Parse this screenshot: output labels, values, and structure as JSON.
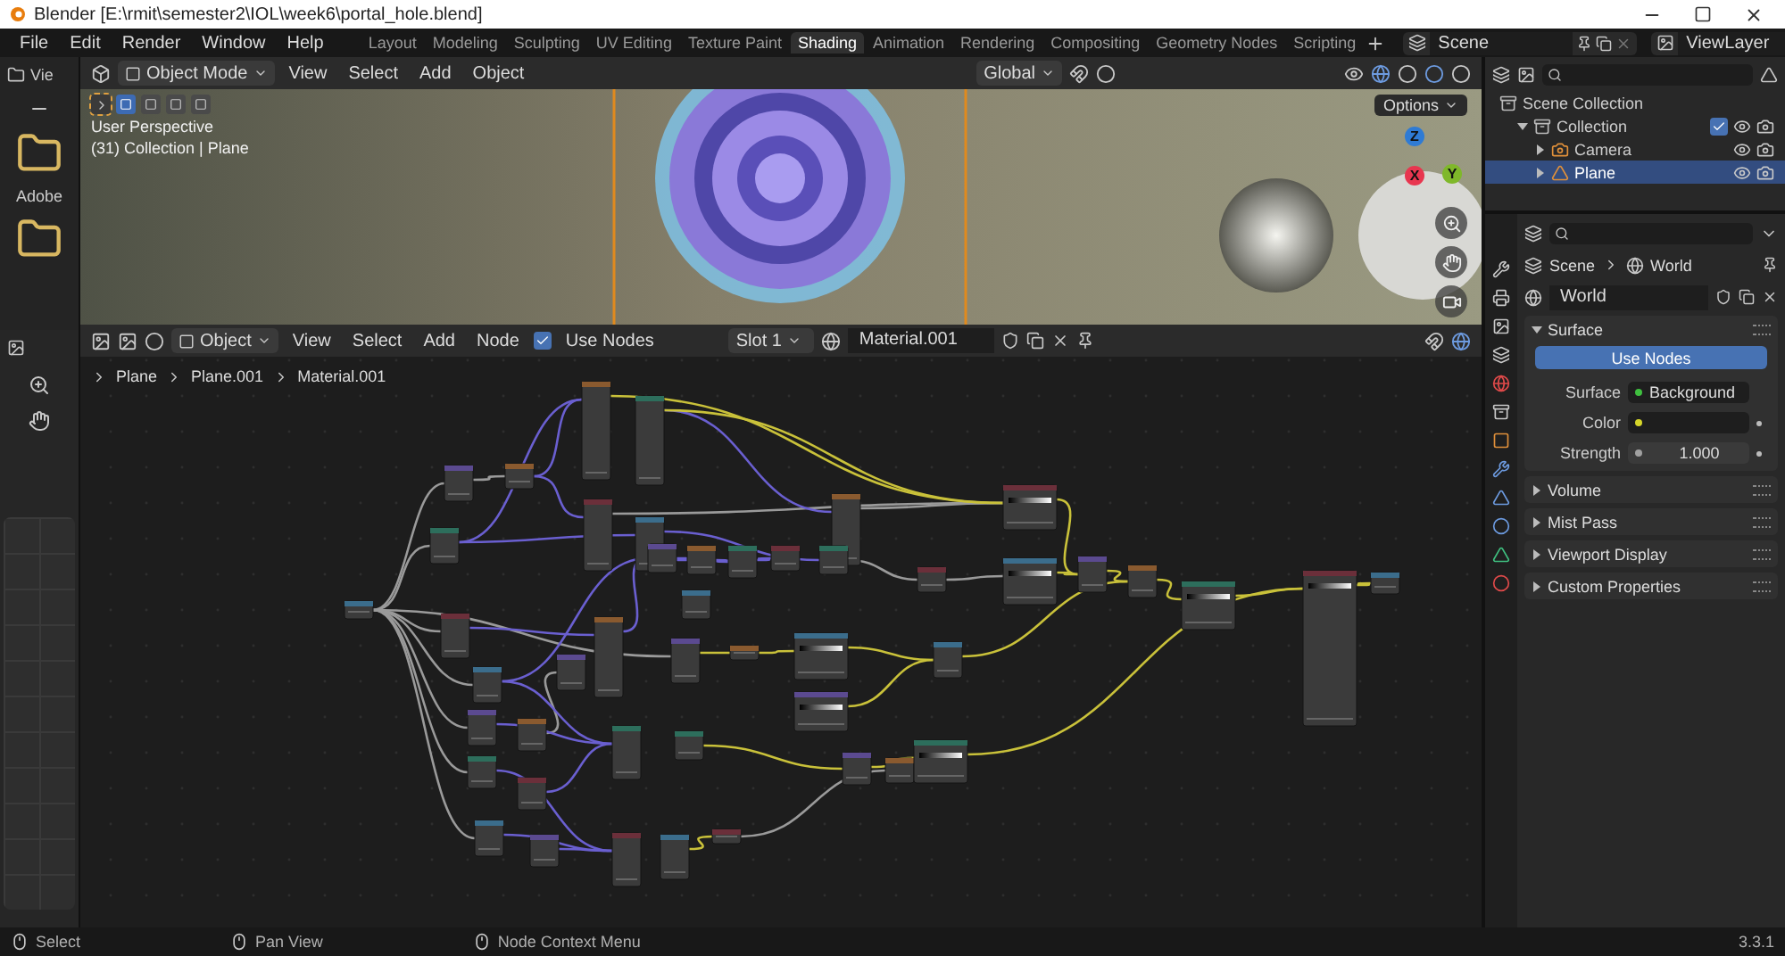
{
  "window": {
    "title": "Blender [E:\\rmit\\semester2\\IOL\\week6\\portal_hole.blend]"
  },
  "menu": [
    "File",
    "Edit",
    "Render",
    "Window",
    "Help"
  ],
  "workspaces": [
    {
      "label": "Layout",
      "selected": false
    },
    {
      "label": "Modeling",
      "selected": false
    },
    {
      "label": "Sculpting",
      "selected": false
    },
    {
      "label": "UV Editing",
      "selected": false
    },
    {
      "label": "Texture Paint",
      "selected": false
    },
    {
      "label": "Shading",
      "selected": true
    },
    {
      "label": "Animation",
      "selected": false
    },
    {
      "label": "Rendering",
      "selected": false
    },
    {
      "label": "Compositing",
      "selected": false
    },
    {
      "label": "Geometry Nodes",
      "selected": false
    },
    {
      "label": "Scripting",
      "selected": false
    }
  ],
  "scene": "Scene",
  "view_layer": "ViewLayer",
  "file_browser": {
    "header": "Vie",
    "items": [
      "Adobe"
    ]
  },
  "viewport": {
    "mode": "Object Mode",
    "menu": [
      "View",
      "Select",
      "Add",
      "Object"
    ],
    "orientation": "Global",
    "options": "Options",
    "overlay_lines": [
      "User Perspective",
      "(31) Collection | Plane"
    ],
    "gizmo": [
      {
        "label": "Z",
        "color": "#2f7bd4"
      },
      {
        "label": "X",
        "color": "#e8364f"
      },
      {
        "label": "Y",
        "color": "#7fb82a"
      }
    ]
  },
  "node_editor": {
    "type": "Object",
    "menu": [
      "View",
      "Select",
      "Add",
      "Node"
    ],
    "use_nodes": {
      "label": "Use Nodes",
      "checked": true
    },
    "slot": "Slot 1",
    "material": "Material.001",
    "breadcrumbs": [
      "Plane",
      "Plane.001",
      "Material.001"
    ]
  },
  "outliner": {
    "items": [
      {
        "label": "Scene Collection",
        "kind": "collection",
        "selected": false,
        "children": [
          {
            "label": "Collection",
            "kind": "collection",
            "expanded": true,
            "checked": true,
            "selected": false,
            "children": [
              {
                "label": "Camera",
                "kind": "camera",
                "expanded": false,
                "selected": false
              },
              {
                "label": "Plane",
                "kind": "mesh",
                "expanded": false,
                "selected": true
              }
            ]
          }
        ]
      }
    ]
  },
  "properties": {
    "breadcrumbs": [
      "Scene",
      "World"
    ],
    "world": "World",
    "panels": [
      {
        "title": "Surface",
        "expanded": true,
        "button": "Use Nodes",
        "fields": [
          {
            "label": "Surface",
            "value": "Background",
            "color": "#3fbf3f"
          },
          {
            "label": "Color",
            "color": "#d6d62a"
          },
          {
            "label": "Strength",
            "value": "1.000",
            "color": "#a0a0a0"
          }
        ]
      },
      {
        "title": "Volume",
        "expanded": false
      },
      {
        "title": "Mist Pass",
        "expanded": false
      },
      {
        "title": "Viewport Display",
        "expanded": false
      },
      {
        "title": "Custom Properties",
        "expanded": false
      }
    ]
  },
  "status_bar": {
    "hints": [
      "Select",
      "Pan View",
      "Node Context Menu"
    ],
    "version": "3.3.1"
  }
}
